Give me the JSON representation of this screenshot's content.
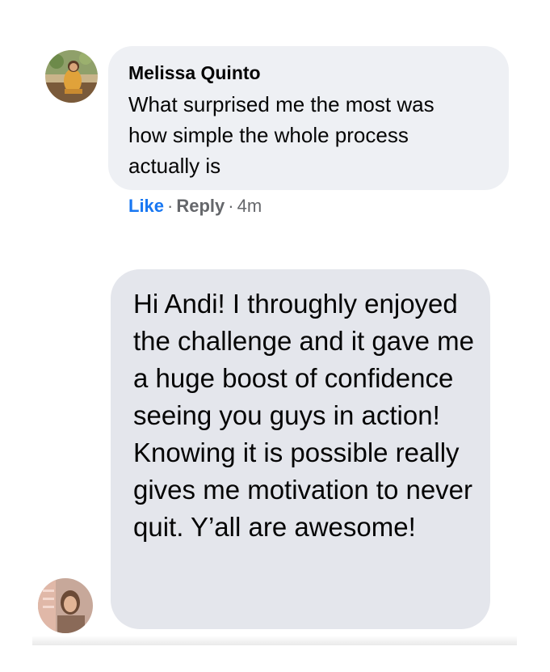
{
  "comments": [
    {
      "author": "Melissa Quinto",
      "text": "What surprised me the most was how simple the whole process actually is",
      "actions": {
        "like": "Like",
        "reply": "Reply",
        "separator": "·",
        "timestamp": "4m"
      }
    },
    {
      "text": "Hi Andi! I throughly enjoyed the challenge and it gave me a huge boost of confidence seeing you guys in action! Knowing it is possible really gives me motivation to never quit. Y’all are awesome!"
    }
  ],
  "colors": {
    "bubble": "#e4e6eb",
    "link_blue": "#1877f2",
    "meta_gray": "#65676b",
    "text": "#050505"
  },
  "icons": {
    "avatar_1": "profile-photo",
    "avatar_2": "profile-photo"
  }
}
